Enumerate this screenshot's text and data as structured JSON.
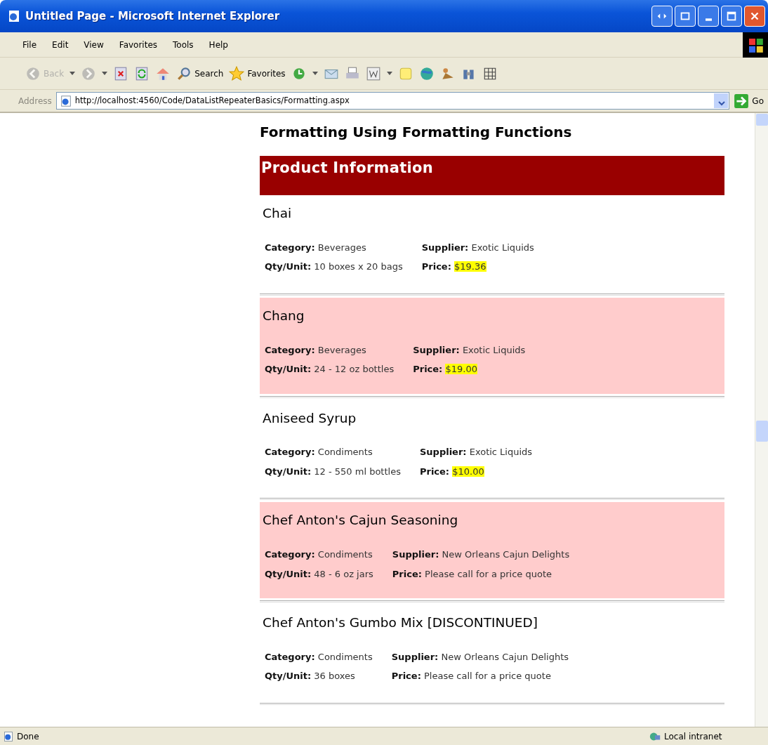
{
  "window": {
    "title": "Untitled Page - Microsoft Internet Explorer"
  },
  "menu": [
    "File",
    "Edit",
    "View",
    "Favorites",
    "Tools",
    "Help"
  ],
  "toolbar": [
    {
      "kind": "back",
      "label": "Back",
      "disabled": true
    },
    {
      "kind": "forward",
      "disabled": true
    },
    {
      "kind": "stop"
    },
    {
      "kind": "refresh"
    },
    {
      "kind": "home"
    },
    {
      "kind": "search",
      "label": "Search"
    },
    {
      "kind": "favorites",
      "label": "Favorites"
    },
    {
      "kind": "history"
    },
    {
      "kind": "mail"
    },
    {
      "kind": "print"
    },
    {
      "kind": "edit"
    },
    {
      "kind": "notes"
    },
    {
      "kind": "globe"
    },
    {
      "kind": "messenger"
    },
    {
      "kind": "research"
    },
    {
      "kind": "grid"
    }
  ],
  "address": {
    "label": "Address",
    "url": "http://localhost:4560/Code/DataListRepeaterBasics/Formatting.aspx",
    "go": "Go"
  },
  "page": {
    "heading": "Formatting Using Formatting Functions",
    "banner": "Product Information",
    "products": [
      {
        "name": "Chai",
        "highlighted": false,
        "category_label": "Category:",
        "category": "Beverages",
        "supplier_label": "Supplier:",
        "supplier": "Exotic Liquids",
        "qty_label": "Qty/Unit:",
        "qty": "10 boxes x 20 bags",
        "price_label": "Price:",
        "price": "$19.36",
        "price_highlighted": true
      },
      {
        "name": "Chang",
        "highlighted": true,
        "category_label": "Category:",
        "category": "Beverages",
        "supplier_label": "Supplier:",
        "supplier": "Exotic Liquids",
        "qty_label": "Qty/Unit:",
        "qty": "24 - 12 oz bottles",
        "price_label": "Price:",
        "price": "$19.00",
        "price_highlighted": true
      },
      {
        "name": "Aniseed Syrup",
        "highlighted": false,
        "category_label": "Category:",
        "category": "Condiments",
        "supplier_label": "Supplier:",
        "supplier": "Exotic Liquids",
        "qty_label": "Qty/Unit:",
        "qty": "12 - 550 ml bottles",
        "price_label": "Price:",
        "price": "$10.00",
        "price_highlighted": true
      },
      {
        "name": "Chef Anton's Cajun Seasoning",
        "highlighted": true,
        "category_label": "Category:",
        "category": "Condiments",
        "supplier_label": "Supplier:",
        "supplier": "New Orleans Cajun Delights",
        "qty_label": "Qty/Unit:",
        "qty": "48 - 6 oz jars",
        "price_label": "Price:",
        "price": "Please call for a price quote",
        "price_highlighted": false
      },
      {
        "name": "Chef Anton's Gumbo Mix [DISCONTINUED]",
        "highlighted": false,
        "category_label": "Category:",
        "category": "Condiments",
        "supplier_label": "Supplier:",
        "supplier": "New Orleans Cajun Delights",
        "qty_label": "Qty/Unit:",
        "qty": "36 boxes",
        "price_label": "Price:",
        "price": "Please call for a price quote",
        "price_highlighted": false
      }
    ]
  },
  "status_bar": {
    "text": "Done",
    "zone": "Local intranet"
  }
}
